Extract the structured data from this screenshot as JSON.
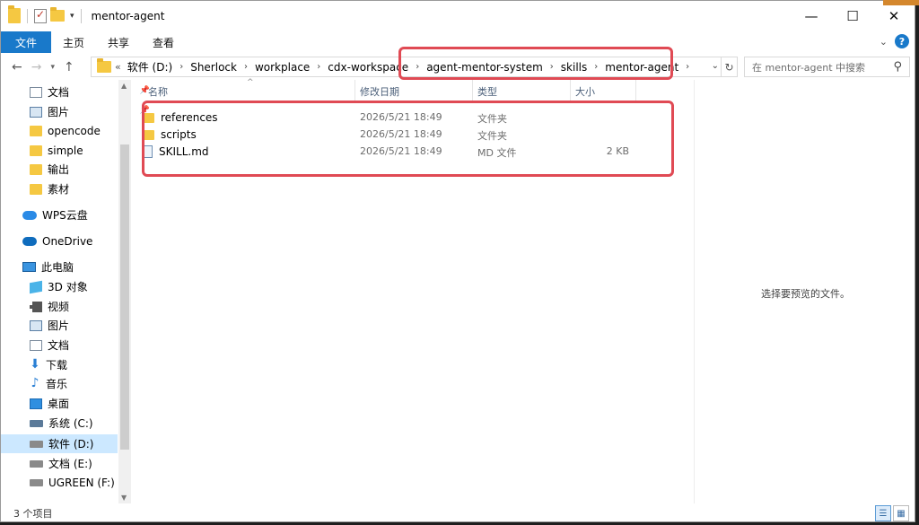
{
  "window": {
    "title": "mentor-agent"
  },
  "ribbon": {
    "tabs": [
      "文件",
      "主页",
      "共享",
      "查看"
    ]
  },
  "address": {
    "lead": "«",
    "crumbs": [
      "软件 (D:)",
      "Sherlock",
      "workplace",
      "cdx-workspace",
      "agent-mentor-system",
      "skills",
      "mentor-agent"
    ]
  },
  "search": {
    "placeholder": "在 mentor-agent 中搜索"
  },
  "nav": {
    "items": [
      {
        "label": "文档",
        "icon": "documents-icon",
        "pinned": true
      },
      {
        "label": "图片",
        "icon": "pictures-icon",
        "pinned": true
      },
      {
        "label": "opencode",
        "icon": "folder-icon"
      },
      {
        "label": "simple",
        "icon": "folder-icon"
      },
      {
        "label": "输出",
        "icon": "folder-icon"
      },
      {
        "label": "素材",
        "icon": "folder-icon"
      },
      {
        "label": "WPS云盘",
        "icon": "wps-cloud-icon"
      },
      {
        "label": "OneDrive",
        "icon": "onedrive-icon"
      },
      {
        "label": "此电脑",
        "icon": "this-pc-icon"
      },
      {
        "label": "3D 对象",
        "icon": "3d-objects-icon"
      },
      {
        "label": "视频",
        "icon": "videos-icon"
      },
      {
        "label": "图片",
        "icon": "pictures-icon"
      },
      {
        "label": "文档",
        "icon": "documents-icon"
      },
      {
        "label": "下载",
        "icon": "downloads-icon"
      },
      {
        "label": "音乐",
        "icon": "music-icon"
      },
      {
        "label": "桌面",
        "icon": "desktop-icon"
      },
      {
        "label": "系统 (C:)",
        "icon": "system-drive-icon"
      },
      {
        "label": "软件 (D:)",
        "icon": "drive-icon",
        "selected": true
      },
      {
        "label": "文档 (E:)",
        "icon": "drive-icon"
      },
      {
        "label": "UGREEN (F:)",
        "icon": "drive-icon"
      }
    ]
  },
  "columns": {
    "name": "名称",
    "date": "修改日期",
    "type": "类型",
    "size": "大小"
  },
  "files": [
    {
      "name": "references",
      "date": "2026/5/21 18:49",
      "type": "文件夹",
      "size": "",
      "icon": "folder-icon"
    },
    {
      "name": "scripts",
      "date": "2026/5/21 18:49",
      "type": "文件夹",
      "size": "",
      "icon": "folder-icon"
    },
    {
      "name": "SKILL.md",
      "date": "2026/5/21 18:49",
      "type": "MD 文件",
      "size": "2 KB",
      "icon": "md-file-icon"
    }
  ],
  "preview": {
    "message": "选择要预览的文件。"
  },
  "status": {
    "count": "3 个项目"
  },
  "colors": {
    "accent": "#1979ca",
    "highlight": "#e04a54",
    "selection": "#cce8ff"
  }
}
